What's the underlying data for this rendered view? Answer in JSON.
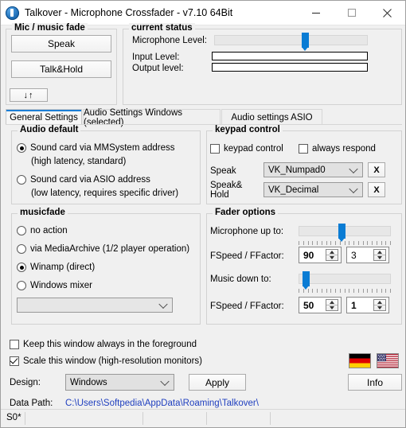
{
  "window": {
    "title": "Talkover - Microphone Crossfader - v7.10 64Bit",
    "icon": "app-icon",
    "minimize_label": "minimize-icon",
    "maximize_label": "maximize-icon",
    "close_label": "close-icon"
  },
  "mic_music_fade": {
    "title": "Mic / music fade",
    "speak_button": "Speak",
    "talkhold_button": "Talk&Hold",
    "arrows_button": "↓↑"
  },
  "current_status": {
    "title": "current status",
    "mic_level_label": "Microphone Level:",
    "mic_level_value": 60,
    "input_level_label": "Input Level:",
    "input_level_value": 0,
    "output_level_label": "Output level:",
    "output_level_value": 0
  },
  "tabs": [
    {
      "label": "General Settings",
      "active": true
    },
    {
      "label": "Audio Settings Windows (selected)",
      "active": false
    },
    {
      "label": "Audio settings ASIO",
      "active": false
    }
  ],
  "audio_default": {
    "title": "Audio default",
    "options": [
      {
        "label": "Sound card via MMSystem address",
        "sub": "(high latency, standard)",
        "selected": true
      },
      {
        "label": "Sound card via ASIO address",
        "sub": "(low latency, requires specific driver)",
        "selected": false
      }
    ]
  },
  "musicfade": {
    "title": "musicfade",
    "options": [
      {
        "label": "no action",
        "selected": false
      },
      {
        "label": "via MediaArchive (1/2 player operation)",
        "selected": false
      },
      {
        "label": "Winamp (direct)",
        "selected": true
      },
      {
        "label": "Windows mixer",
        "selected": false
      }
    ],
    "device_combo_value": "",
    "device_combo_placeholder": ""
  },
  "keypad_control": {
    "title": "keypad control",
    "keypad_checkbox_label": "keypad control",
    "keypad_checkbox_checked": false,
    "always_respond_label": "always respond",
    "always_respond_checked": false,
    "speak_label": "Speak",
    "speak_value": "VK_Numpad0",
    "speak_clear_label": "X",
    "speak_hold_label_1": "Speak&",
    "speak_hold_label_2": "Hold",
    "speak_hold_value": "VK_Decimal",
    "speak_hold_clear_label": "X"
  },
  "fader_options": {
    "title": "Fader options",
    "mic_up_label": "Microphone up to:",
    "mic_up_value": 47,
    "mic_fspeed_label": "FSpeed / FFactor:",
    "mic_fspeed": "90",
    "mic_ffactor": "3",
    "music_down_label": "Music down to:",
    "music_down_value": 5,
    "music_fspeed_label": "FSpeed / FFactor:",
    "music_fspeed": "50",
    "music_ffactor": "1"
  },
  "bottom": {
    "foreground_label": "Keep this window always in the foreground",
    "foreground_checked": false,
    "scale_label": "Scale this window (high-resolution monitors)",
    "scale_checked": true,
    "design_label": "Design:",
    "design_value": "Windows",
    "apply_button": "Apply",
    "info_button": "Info",
    "data_path_label": "Data Path:",
    "data_path_value": "C:\\Users\\Softpedia\\AppData\\Roaming\\Talkover\\",
    "flag_de": "german-flag",
    "flag_us": "us-flag"
  },
  "statusbar": {
    "text": "S0*"
  },
  "colors": {
    "accent": "#0a7cd4",
    "link": "#1f3fbf",
    "window_bg": "#f0f0f0"
  }
}
